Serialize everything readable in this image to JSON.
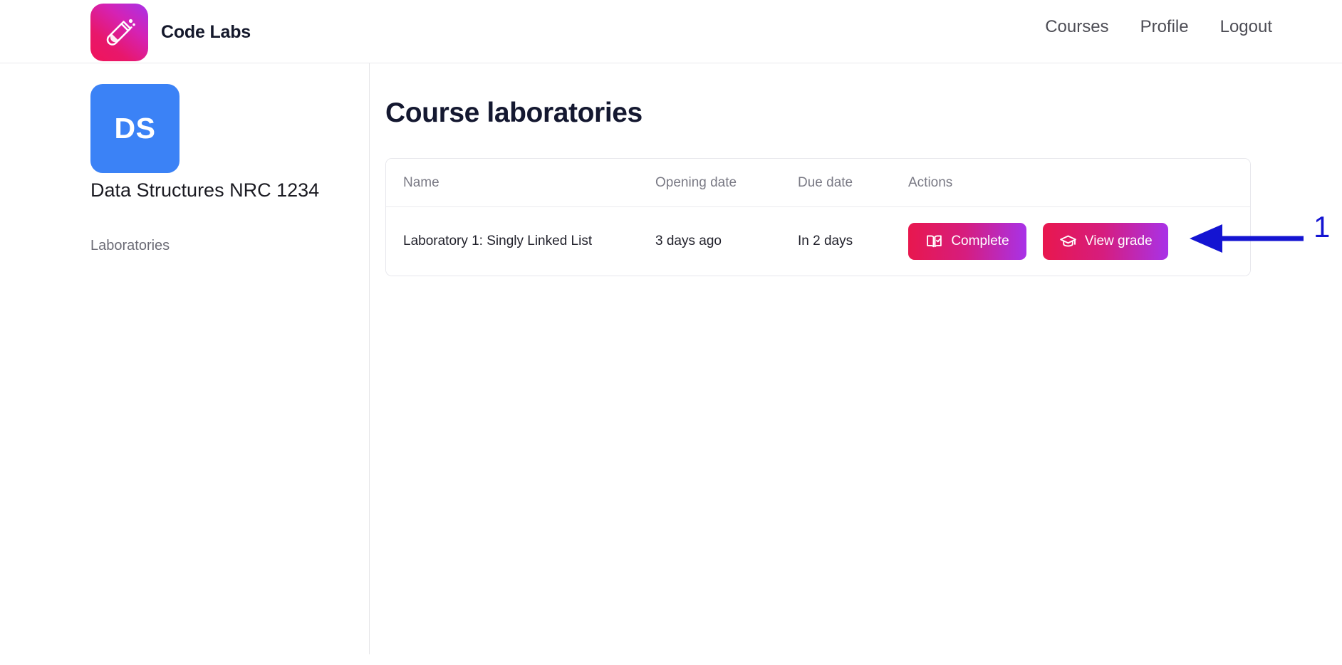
{
  "header": {
    "brand_name": "Code Labs",
    "logo_icon": "test-tube-icon",
    "logo_gradient_from": "#f0145a",
    "logo_gradient_to": "#a832e8",
    "nav": [
      {
        "label": "Courses",
        "name": "courses"
      },
      {
        "label": "Profile",
        "name": "profile"
      },
      {
        "label": "Logout",
        "name": "logout"
      }
    ]
  },
  "sidebar": {
    "avatar_initials": "DS",
    "avatar_color": "#3b82f6",
    "course_title": "Data Structures NRC 1234",
    "items": [
      {
        "label": "Laboratories",
        "name": "laboratories"
      }
    ]
  },
  "main": {
    "page_title": "Course laboratories",
    "table": {
      "columns": [
        "Name",
        "Opening date",
        "Due date",
        "Actions"
      ],
      "rows": [
        {
          "name": "Laboratory 1: Singly Linked List",
          "opening_date": "3 days ago",
          "due_date": "In 2 days",
          "actions": [
            {
              "label": "Complete",
              "icon": "book-check-icon",
              "name": "complete"
            },
            {
              "label": "View grade",
              "icon": "graduation-cap-icon",
              "name": "view-grade"
            }
          ]
        }
      ]
    }
  },
  "annotation": {
    "number": "1",
    "color": "#1414d2",
    "direction": "left"
  }
}
